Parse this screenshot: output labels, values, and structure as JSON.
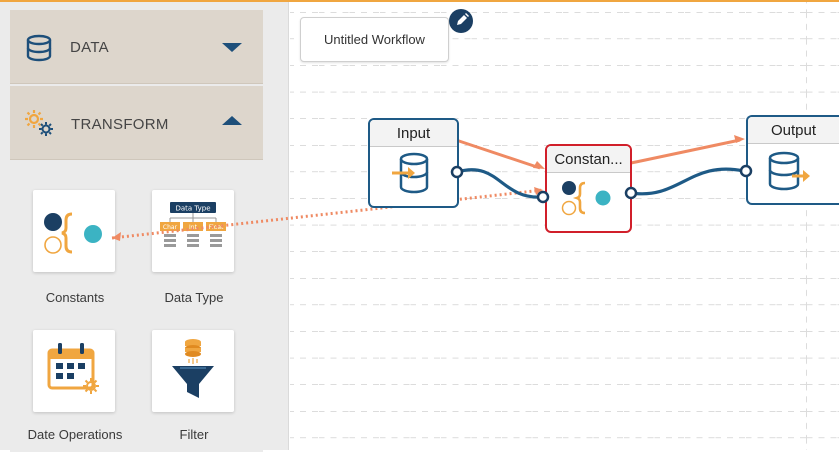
{
  "sidebar": {
    "sections": [
      {
        "label": "DATA",
        "icon": "database-icon",
        "state": "collapsed"
      },
      {
        "label": "TRANSFORM",
        "icon": "gears-icon",
        "state": "expanded"
      }
    ],
    "tiles": [
      {
        "label": "Constants",
        "icon": "constants-icon"
      },
      {
        "label": "Data Type",
        "icon": "data-type-icon",
        "diagram_title": "Data Type",
        "diagram_items": [
          "Char",
          "Int",
          "Float"
        ]
      },
      {
        "label": "Date Operations",
        "icon": "calendar-gear-icon"
      },
      {
        "label": "Filter",
        "icon": "funnel-icon"
      }
    ]
  },
  "workflow": {
    "name": "Untitled Workflow",
    "nodes": [
      {
        "label": "Input",
        "icon": "database-in-icon"
      },
      {
        "label": "Constan...",
        "icon": "constants-icon",
        "selected": true
      },
      {
        "label": "Output",
        "icon": "database-out-icon"
      }
    ]
  },
  "colors": {
    "accent_orange": "#f0a640",
    "node_border": "#1e5a86",
    "selected_border": "#d11f2a",
    "arrow": "#ef8a63",
    "connector": "#1e5a86",
    "header_bg": "#ddd6cc"
  }
}
